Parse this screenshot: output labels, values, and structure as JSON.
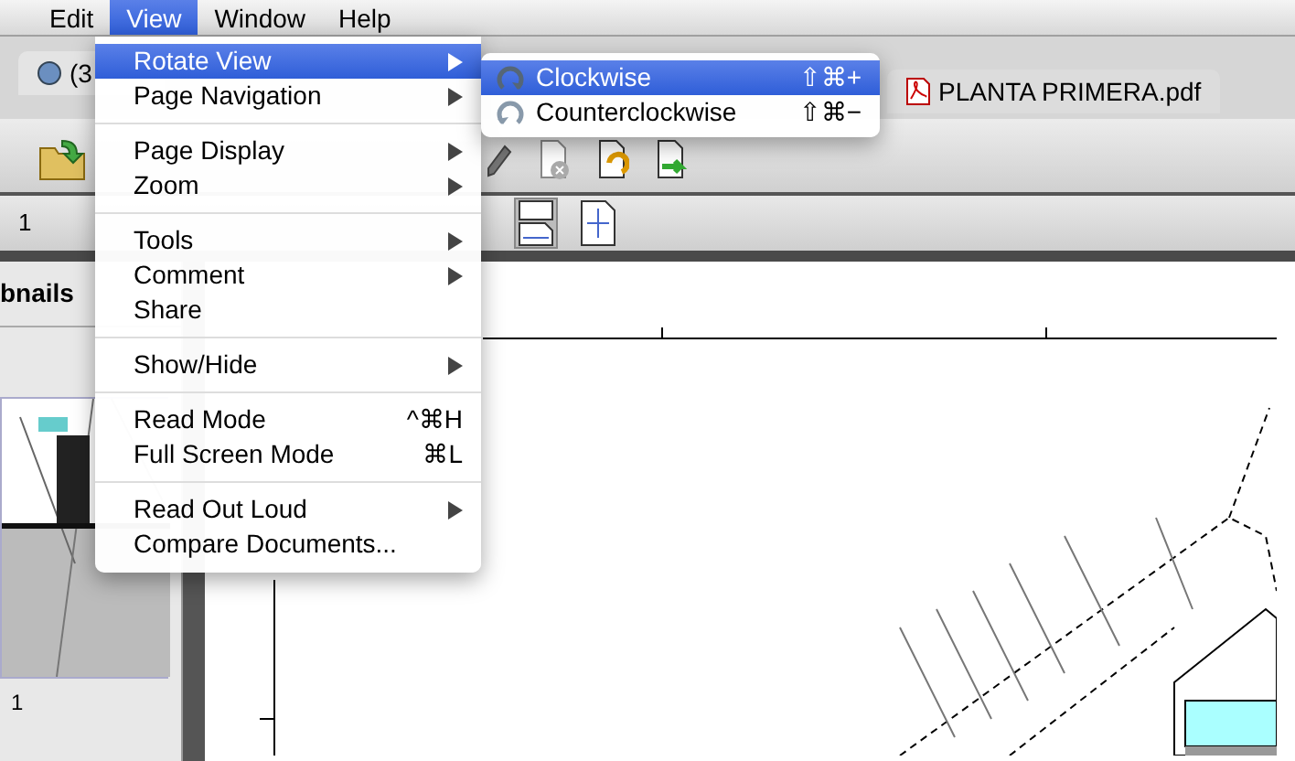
{
  "menubar": [
    {
      "label": "Edit",
      "selected": false
    },
    {
      "label": "View",
      "selected": true
    },
    {
      "label": "Window",
      "selected": false
    },
    {
      "label": "Help",
      "selected": false
    }
  ],
  "tabs": [
    {
      "label": "(3"
    },
    {
      "label": "PLANTA PRIMERA.pdf"
    }
  ],
  "page_number": "1",
  "sidebar": {
    "title": "bnails",
    "thumbnail_label": "1"
  },
  "menu": {
    "groups": [
      [
        {
          "label": "Rotate View",
          "submenu": true,
          "selected": true
        },
        {
          "label": "Page Navigation",
          "submenu": true,
          "selected": false
        }
      ],
      [
        {
          "label": "Page Display",
          "submenu": true,
          "selected": false
        },
        {
          "label": "Zoom",
          "submenu": true,
          "selected": false
        }
      ],
      [
        {
          "label": "Tools",
          "submenu": true,
          "selected": false
        },
        {
          "label": "Comment",
          "submenu": true,
          "selected": false
        },
        {
          "label": "Share",
          "submenu": false,
          "selected": false
        }
      ],
      [
        {
          "label": "Show/Hide",
          "submenu": true,
          "selected": false
        }
      ],
      [
        {
          "label": "Read Mode",
          "shortcut": "^⌘H",
          "submenu": false,
          "selected": false
        },
        {
          "label": "Full Screen Mode",
          "shortcut": "⌘L",
          "submenu": false,
          "selected": false
        }
      ],
      [
        {
          "label": "Read Out Loud",
          "submenu": true,
          "selected": false
        },
        {
          "label": "Compare Documents...",
          "submenu": false,
          "selected": false
        }
      ]
    ]
  },
  "submenu": {
    "items": [
      {
        "label": "Clockwise",
        "shortcut": "⇧⌘+",
        "kind": "clockwise",
        "selected": true
      },
      {
        "label": "Counterclockwise",
        "shortcut": "⇧⌘−",
        "kind": "counterclockwise",
        "selected": false
      }
    ]
  }
}
